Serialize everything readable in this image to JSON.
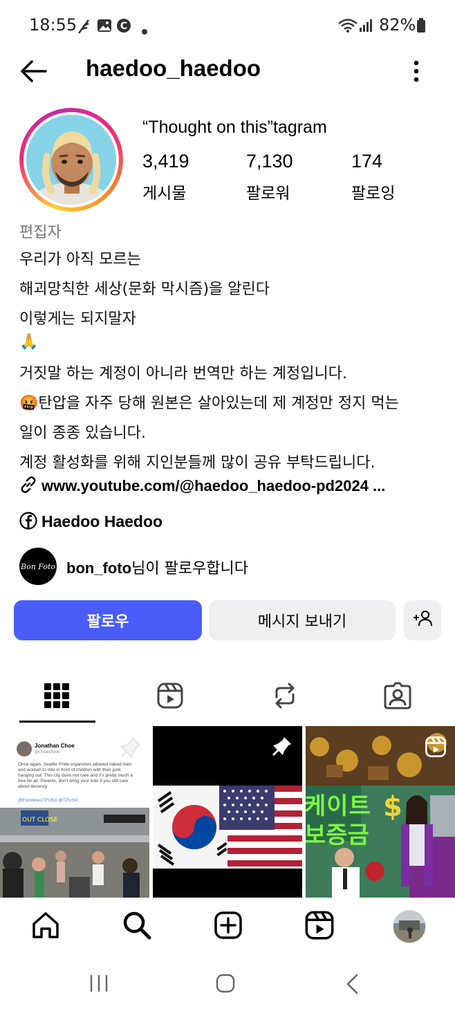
{
  "status_bar": {
    "time": "18:55",
    "battery": "82%"
  },
  "header": {
    "username": "haedoo_haedoo"
  },
  "profile": {
    "display_name": "“Thought on this”tagram",
    "stats": [
      {
        "value": "3,419",
        "label": "게시물"
      },
      {
        "value": "7,130",
        "label": "팔로워"
      },
      {
        "value": "174",
        "label": "팔로잉"
      }
    ],
    "category": "편집자",
    "bio": [
      "우리가 아직 모르는",
      "해괴망칙한 세상(문화 막시즘)을 알린다",
      "이렇게는 되지말자",
      "🙏",
      "거짓말 하는 계정이 아니라 번역만 하는 계정입니다.",
      "🤬탄압을 자주 당해 원본은 살아있는데 제 계정만 정지 먹는",
      "일이 종종 있습니다.",
      "계정 활성화를 위해 지인분들께 많이 공유 부탁드립니다."
    ],
    "link": "www.youtube.com/@haedoo_haedoo-pd2024 ...",
    "facebook": "Haedoo Haedoo",
    "mutual": {
      "avatar_text": "Bon Foto",
      "account": "bon_foto",
      "suffix": "님이 팔로우합니다"
    }
  },
  "actions": {
    "follow": "팔로우",
    "message": "메시지 보내기"
  },
  "tabs": [
    "grid-icon",
    "reels-icon",
    "reposts-icon",
    "tagged-icon"
  ],
  "grid": {
    "post1": {
      "author": "Jonathan Choe",
      "handle": "@choeshow",
      "text": "Once again, Seattle Pride organizers allowed naked men and women to ride in front of children with their junk hanging out. This city does not care and it's pretty much a free for all. Parents, don't bring your kids if you still care about decency.",
      "tags": "@FrontlinesTPUSA @TPUSA"
    },
    "post3_text_a": "케이트",
    "post3_text_b": "보증금"
  },
  "bottom_nav": [
    "home-icon",
    "search-icon",
    "create-icon",
    "reels-icon",
    "profile-avatar"
  ],
  "colors": {
    "follow_button": "#4a5df9",
    "secondary_button": "#efeff1"
  }
}
